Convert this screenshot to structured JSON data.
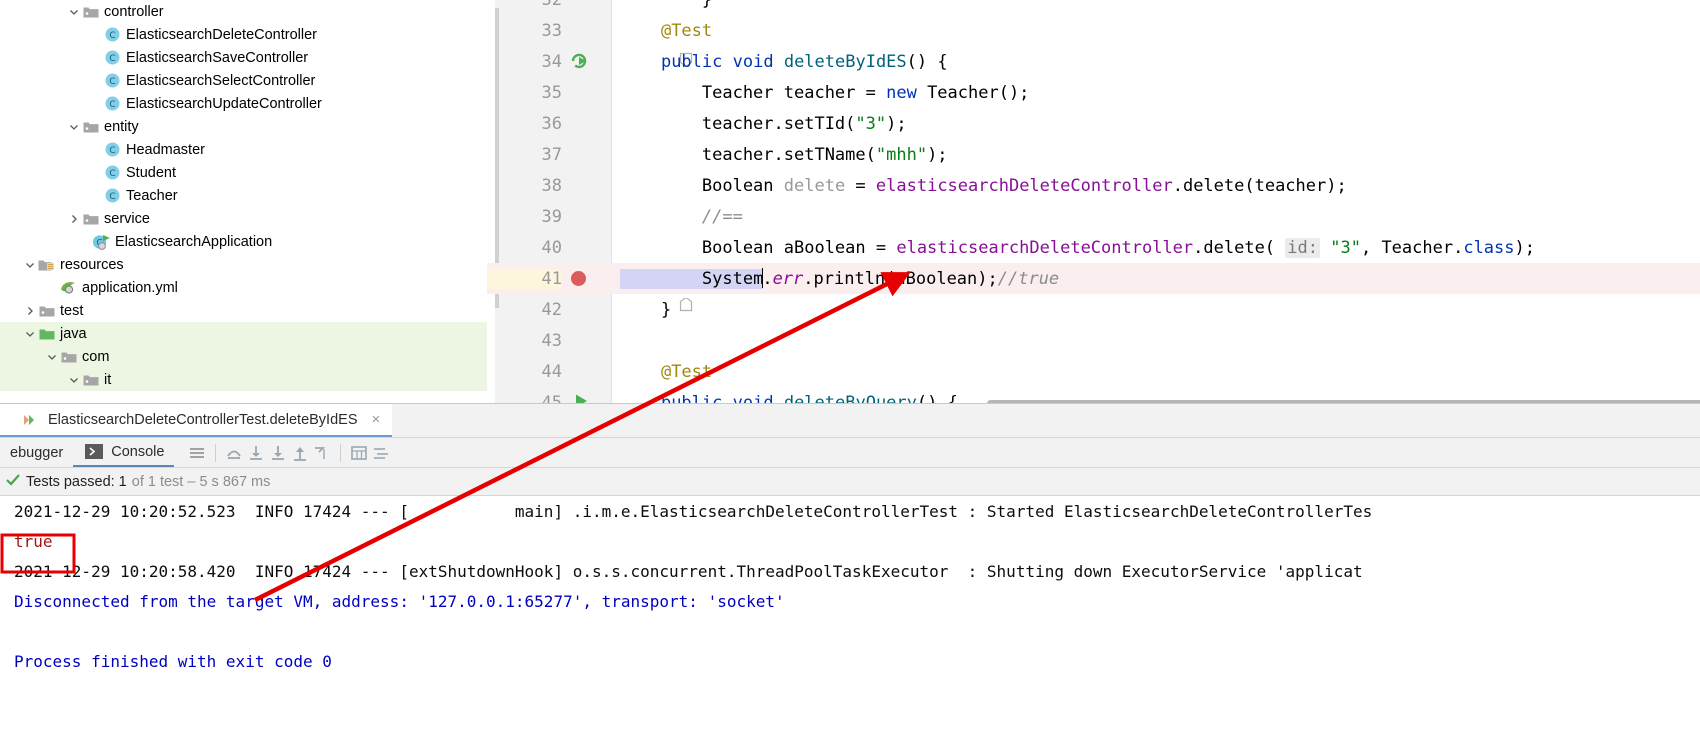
{
  "project_tree": {
    "items": [
      {
        "label": "controller",
        "type": "folder",
        "depth": 3,
        "twisty": "down",
        "icon": "folder-icon"
      },
      {
        "label": "ElasticsearchDeleteController",
        "type": "class",
        "depth": 4,
        "twisty": "",
        "icon": "class-icon"
      },
      {
        "label": "ElasticsearchSaveController",
        "type": "class",
        "depth": 4,
        "twisty": "",
        "icon": "class-icon"
      },
      {
        "label": "ElasticsearchSelectController",
        "type": "class",
        "depth": 4,
        "twisty": "",
        "icon": "class-icon"
      },
      {
        "label": "ElasticsearchUpdateController",
        "type": "class",
        "depth": 4,
        "twisty": "",
        "icon": "class-icon"
      },
      {
        "label": "entity",
        "type": "folder",
        "depth": 3,
        "twisty": "down",
        "icon": "folder-icon"
      },
      {
        "label": "Headmaster",
        "type": "class",
        "depth": 4,
        "twisty": "",
        "icon": "class-icon"
      },
      {
        "label": "Student",
        "type": "class",
        "depth": 4,
        "twisty": "",
        "icon": "class-icon"
      },
      {
        "label": "Teacher",
        "type": "class",
        "depth": 4,
        "twisty": "",
        "icon": "class-icon"
      },
      {
        "label": "service",
        "type": "folder",
        "depth": 3,
        "twisty": "right",
        "icon": "folder-icon"
      },
      {
        "label": "ElasticsearchApplication",
        "type": "runnable-class",
        "depth": 3.5,
        "twisty": "",
        "icon": "spring-run-class-icon"
      },
      {
        "label": "resources",
        "type": "resource-folder",
        "depth": 1,
        "twisty": "down",
        "icon": "resource-folder-icon"
      },
      {
        "label": "application.yml",
        "type": "yml",
        "depth": 2,
        "twisty": "",
        "icon": "spring-yaml-icon"
      },
      {
        "label": "test",
        "type": "folder",
        "depth": 1,
        "twisty": "right",
        "icon": "folder-icon"
      },
      {
        "label": "java",
        "type": "source-folder",
        "depth": 1,
        "twisty": "down",
        "icon": "source-folder-icon",
        "highlight": true
      },
      {
        "label": "com",
        "type": "folder",
        "depth": 2,
        "twisty": "down",
        "icon": "folder-icon",
        "highlight": true
      },
      {
        "label": "it",
        "type": "folder",
        "depth": 3,
        "twisty": "down",
        "icon": "folder-icon",
        "highlight": true
      }
    ]
  },
  "editor": {
    "lines": [
      {
        "no": "32",
        "segments": [
          {
            "t": "        }",
            "c": ""
          }
        ]
      },
      {
        "no": "33",
        "segments": [
          {
            "t": "    ",
            "c": ""
          },
          {
            "t": "@Test",
            "c": "anno"
          }
        ]
      },
      {
        "no": "34",
        "segments": [
          {
            "t": "    ",
            "c": ""
          },
          {
            "t": "public",
            "c": "kw"
          },
          {
            "t": " ",
            "c": ""
          },
          {
            "t": "void",
            "c": "kw"
          },
          {
            "t": " ",
            "c": ""
          },
          {
            "t": "deleteByIdES",
            "c": "meth"
          },
          {
            "t": "() {",
            "c": ""
          }
        ],
        "gutter_icon": "run-test-rerun-icon",
        "fold": "open"
      },
      {
        "no": "35",
        "segments": [
          {
            "t": "        Teacher teacher = ",
            "c": ""
          },
          {
            "t": "new",
            "c": "kw"
          },
          {
            "t": " Teacher();",
            "c": ""
          }
        ]
      },
      {
        "no": "36",
        "segments": [
          {
            "t": "        teacher.setTId(",
            "c": ""
          },
          {
            "t": "\"3\"",
            "c": "str"
          },
          {
            "t": ");",
            "c": ""
          }
        ]
      },
      {
        "no": "37",
        "segments": [
          {
            "t": "        teacher.setTName(",
            "c": ""
          },
          {
            "t": "\"mhh\"",
            "c": "str"
          },
          {
            "t": ");",
            "c": ""
          }
        ]
      },
      {
        "no": "38",
        "segments": [
          {
            "t": "        Boolean ",
            "c": ""
          },
          {
            "t": "delete",
            "c": "gray"
          },
          {
            "t": " = ",
            "c": ""
          },
          {
            "t": "elasticsearchDeleteController",
            "c": "fld"
          },
          {
            "t": ".delete(teacher);",
            "c": ""
          }
        ]
      },
      {
        "no": "39",
        "segments": [
          {
            "t": "        //==",
            "c": "cmt"
          }
        ]
      },
      {
        "no": "40",
        "segments": [
          {
            "t": "        Boolean aBoolean = ",
            "c": ""
          },
          {
            "t": "elasticsearchDeleteController",
            "c": "fld"
          },
          {
            "t": ".delete( ",
            "c": ""
          },
          {
            "t": "id:",
            "c": "hint"
          },
          {
            "t": " ",
            "c": ""
          },
          {
            "t": "\"3\"",
            "c": "str"
          },
          {
            "t": ", Teacher.",
            "c": ""
          },
          {
            "t": "class",
            "c": "kw"
          },
          {
            "t": ");",
            "c": ""
          }
        ]
      },
      {
        "no": "41",
        "segments": [
          {
            "t": "        System.",
            "c": ""
          },
          {
            "t": "err",
            "c": "stat"
          },
          {
            "t": ".println(aBoolean);",
            "c": ""
          },
          {
            "t": "//true",
            "c": "cmt"
          }
        ],
        "current": true,
        "breakpoint": true,
        "bulb": true
      },
      {
        "no": "42",
        "segments": [
          {
            "t": "    }",
            "c": ""
          }
        ],
        "fold": "close"
      },
      {
        "no": "43",
        "segments": [
          {
            "t": "",
            "c": ""
          }
        ]
      },
      {
        "no": "44",
        "segments": [
          {
            "t": "    ",
            "c": ""
          },
          {
            "t": "@Test",
            "c": "anno"
          }
        ]
      },
      {
        "no": "45",
        "segments": [
          {
            "t": "    ",
            "c": ""
          },
          {
            "t": "public",
            "c": "kw"
          },
          {
            "t": " ",
            "c": ""
          },
          {
            "t": "void",
            "c": "kw"
          },
          {
            "t": " ",
            "c": ""
          },
          {
            "t": "deleteByQuery",
            "c": "meth"
          },
          {
            "t": "() {",
            "c": ""
          }
        ],
        "gutter_icon": "run-play-icon"
      }
    ]
  },
  "run_panel": {
    "tab": {
      "label": "ElasticsearchDeleteControllerTest.deleteByIdES",
      "icon": "run-tab-icon",
      "close": "×"
    },
    "toolbar": {
      "debugger_label": "ebugger",
      "console_label": "Console",
      "console_icon": "console-icon",
      "icons": [
        "lines-icon",
        "step-over-icon",
        "step-into-icon",
        "force-step-into-icon",
        "step-out-icon",
        "run-to-cursor-icon",
        "evaluate-icon",
        "settings-icon"
      ]
    },
    "status": {
      "check_icon": "check-icon",
      "passed_label": "Tests passed:",
      "count": "1",
      "detail": "of 1 test – 5 s 867 ms"
    },
    "console_lines": [
      {
        "text": "2021-12-29 10:20:52.523  INFO 17424 --- [           main] .i.m.e.ElasticsearchDeleteControllerTest : Started ElasticsearchDeleteControllerTes",
        "color": "black"
      },
      {
        "text": "true",
        "color": "red"
      },
      {
        "text": "2021-12-29 10:20:58.420  INFO 17424 --- [extShutdownHook] o.s.s.concurrent.ThreadPoolTaskExecutor  : Shutting down ExecutorService 'applicat",
        "color": "black"
      },
      {
        "text": "Disconnected from the target VM, address: '127.0.0.1:65277', transport: 'socket'",
        "color": "blue"
      },
      {
        "text": "",
        "color": "black"
      },
      {
        "text": "Process finished with exit code 0",
        "color": "blue"
      }
    ]
  },
  "annotations": {
    "arrow_color": "#e60000",
    "highlight_box_label": "true-output-highlight"
  },
  "colors": {
    "keyword": "#0033b3",
    "string": "#067d17",
    "field": "#871094",
    "comment": "#8c8c8c",
    "annotation": "#9e880d",
    "method": "#00627a",
    "selection_green": "#edf6e3",
    "current_line": "#fbeeee",
    "accent_red": "#e60000"
  }
}
